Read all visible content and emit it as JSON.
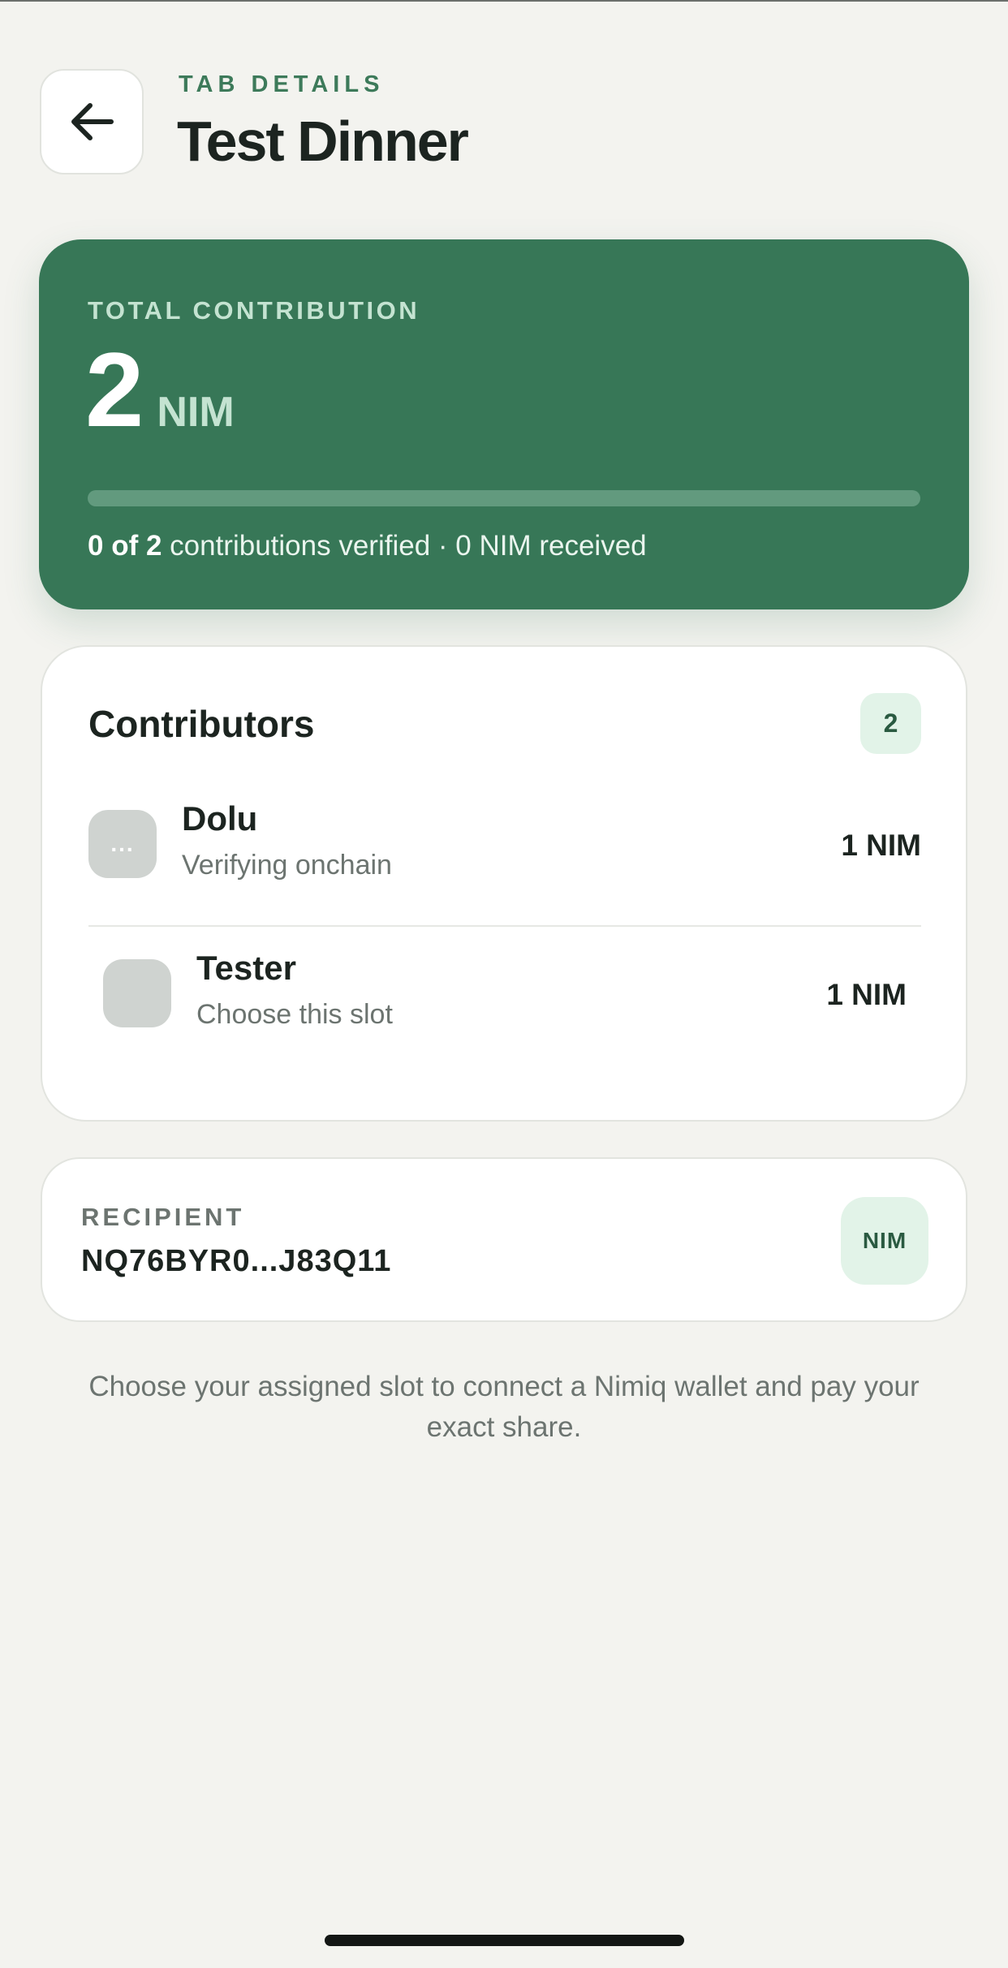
{
  "header": {
    "back_icon": "arrow-left-icon",
    "eyebrow": "TAB DETAILS",
    "title": "Test Dinner"
  },
  "total": {
    "label": "TOTAL CONTRIBUTION",
    "amount": "2",
    "unit": "NIM",
    "progress_fraction": 0,
    "verified_count": "0 of 2",
    "verified_suffix": "contributions verified · 0 NIM received"
  },
  "contributors": {
    "title": "Contributors",
    "count": "2",
    "items": [
      {
        "name": "Dolu",
        "status": "Verifying onchain",
        "amount": "1 NIM",
        "avatar_text": "..."
      },
      {
        "name": "Tester",
        "status": "Choose this slot",
        "amount": "1 NIM",
        "avatar_text": ""
      }
    ]
  },
  "recipient": {
    "label": "RECIPIENT",
    "address": "NQ76BYR0...J83Q11",
    "badge": "NIM"
  },
  "footer": {
    "text": "Choose your assigned slot to connect a Nimiq wallet and pay your exact share."
  },
  "colors": {
    "accent": "#377757",
    "background": "#f3f3ef",
    "badge_bg": "#e2f3e8"
  }
}
